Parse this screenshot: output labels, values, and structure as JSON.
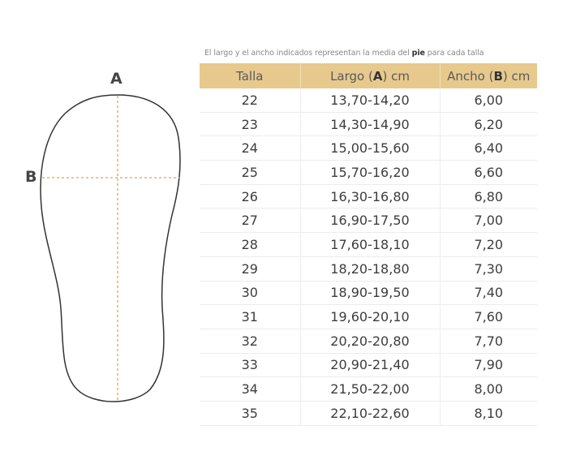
{
  "diagram": {
    "label_a": "A",
    "label_b": "B",
    "outline_color": "#333333",
    "guide_color": "#e8a24a"
  },
  "caption": {
    "before": "El largo y el ancho indicados representan la media del ",
    "bold": "pie",
    "after": " para cada talla"
  },
  "table": {
    "header_bg": "#e7c98e",
    "headers": {
      "talla": "Talla",
      "largo_pre": "Largo (",
      "largo_letter": "A",
      "largo_post": ") cm",
      "ancho_pre": "Ancho (",
      "ancho_letter": "B",
      "ancho_post": ") cm"
    },
    "rows": [
      {
        "talla": "22",
        "largo": "13,70-14,20",
        "ancho": "6,00"
      },
      {
        "talla": "23",
        "largo": "14,30-14,90",
        "ancho": "6,20"
      },
      {
        "talla": "24",
        "largo": "15,00-15,60",
        "ancho": "6,40"
      },
      {
        "talla": "25",
        "largo": "15,70-16,20",
        "ancho": "6,60"
      },
      {
        "talla": "26",
        "largo": "16,30-16,80",
        "ancho": "6,80"
      },
      {
        "talla": "27",
        "largo": "16,90-17,50",
        "ancho": "7,00"
      },
      {
        "talla": "28",
        "largo": "17,60-18,10",
        "ancho": "7,20"
      },
      {
        "talla": "29",
        "largo": "18,20-18,80",
        "ancho": "7,30"
      },
      {
        "talla": "30",
        "largo": "18,90-19,50",
        "ancho": "7,40"
      },
      {
        "talla": "31",
        "largo": "19,60-20,10",
        "ancho": "7,60"
      },
      {
        "talla": "32",
        "largo": "20,20-20,80",
        "ancho": "7,70"
      },
      {
        "talla": "33",
        "largo": "20,90-21,40",
        "ancho": "7,90"
      },
      {
        "talla": "34",
        "largo": "21,50-22,00",
        "ancho": "8,00"
      },
      {
        "talla": "35",
        "largo": "22,10-22,60",
        "ancho": "8,10"
      }
    ]
  }
}
